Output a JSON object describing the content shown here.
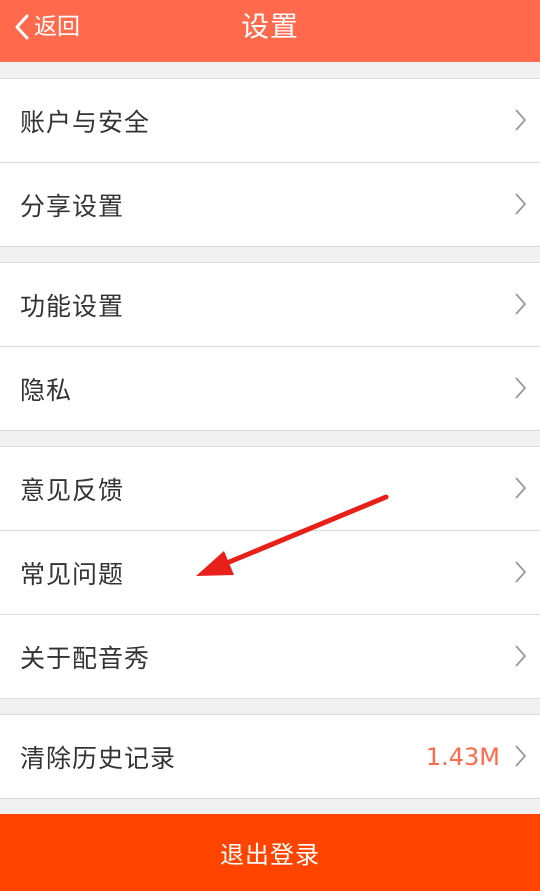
{
  "header": {
    "back_label": "返回",
    "title": "设置"
  },
  "groups": [
    {
      "items": [
        {
          "label": "账户与安全"
        },
        {
          "label": "分享设置"
        }
      ]
    },
    {
      "items": [
        {
          "label": "功能设置"
        },
        {
          "label": "隐私"
        }
      ]
    },
    {
      "items": [
        {
          "label": "意见反馈"
        },
        {
          "label": "常见问题"
        },
        {
          "label": "关于配音秀"
        }
      ]
    },
    {
      "items": [
        {
          "label": "清除历史记录",
          "value": "1.43M"
        }
      ]
    }
  ],
  "logout_label": "退出登录",
  "colors": {
    "header": "#ff6a4d",
    "accent_value": "#ff6a4d",
    "logout": "#ff4400",
    "background": "#f1f1f1",
    "annotation_arrow": "#e8201a"
  }
}
